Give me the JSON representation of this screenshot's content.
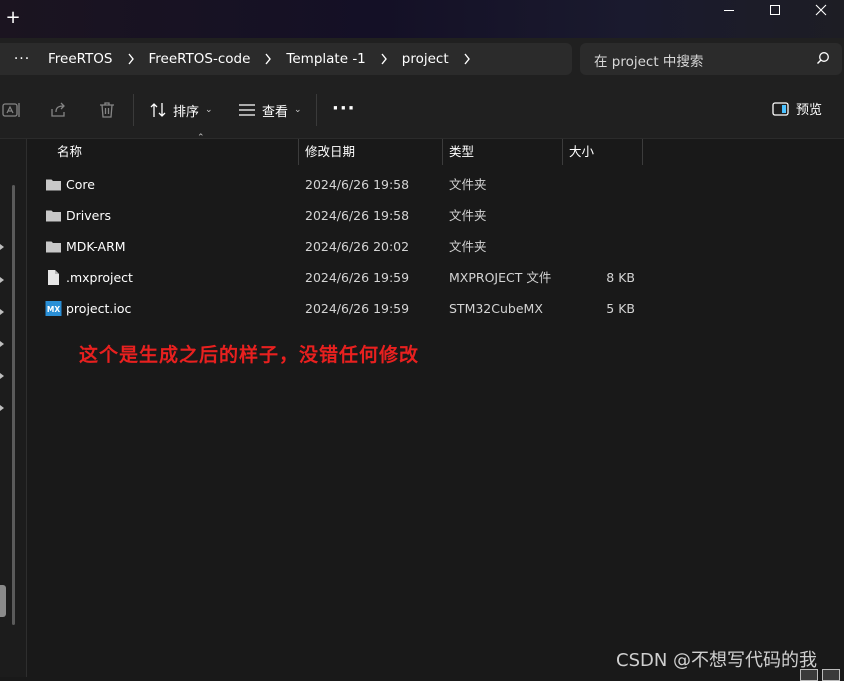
{
  "titlebar": {
    "new_tab": "+"
  },
  "address": {
    "overflow": "···",
    "crumbs": [
      "FreeRTOS",
      "FreeRTOS-code",
      "Template -1",
      "project"
    ],
    "search_placeholder": "在 project 中搜索"
  },
  "toolbar": {
    "sort_label": "排序",
    "view_label": "查看",
    "more": "···",
    "preview_label": "预览"
  },
  "columns": {
    "name": "名称",
    "date": "修改日期",
    "type": "类型",
    "size": "大小"
  },
  "files": [
    {
      "icon": "folder-icon",
      "name": "Core",
      "date": "2024/6/26 19:58",
      "type": "文件夹",
      "size": ""
    },
    {
      "icon": "folder-icon",
      "name": "Drivers",
      "date": "2024/6/26 19:58",
      "type": "文件夹",
      "size": ""
    },
    {
      "icon": "folder-icon",
      "name": "MDK-ARM",
      "date": "2024/6/26 20:02",
      "type": "文件夹",
      "size": ""
    },
    {
      "icon": "file-icon",
      "name": ".mxproject",
      "date": "2024/6/26 19:59",
      "type": "MXPROJECT 文件",
      "size": "8 KB"
    },
    {
      "icon": "stm32cubemx-icon",
      "name": "project.ioc",
      "date": "2024/6/26 19:59",
      "type": "STM32CubeMX",
      "size": "5 KB"
    }
  ],
  "annotation": "这个是生成之后的样子，没错任何修改",
  "watermark": "CSDN @不想写代码的我",
  "colors": {
    "background": "#191919",
    "annotation": "#e8201f",
    "folder": "#c8c8c8",
    "mx_badge": "#2a8fd6"
  }
}
